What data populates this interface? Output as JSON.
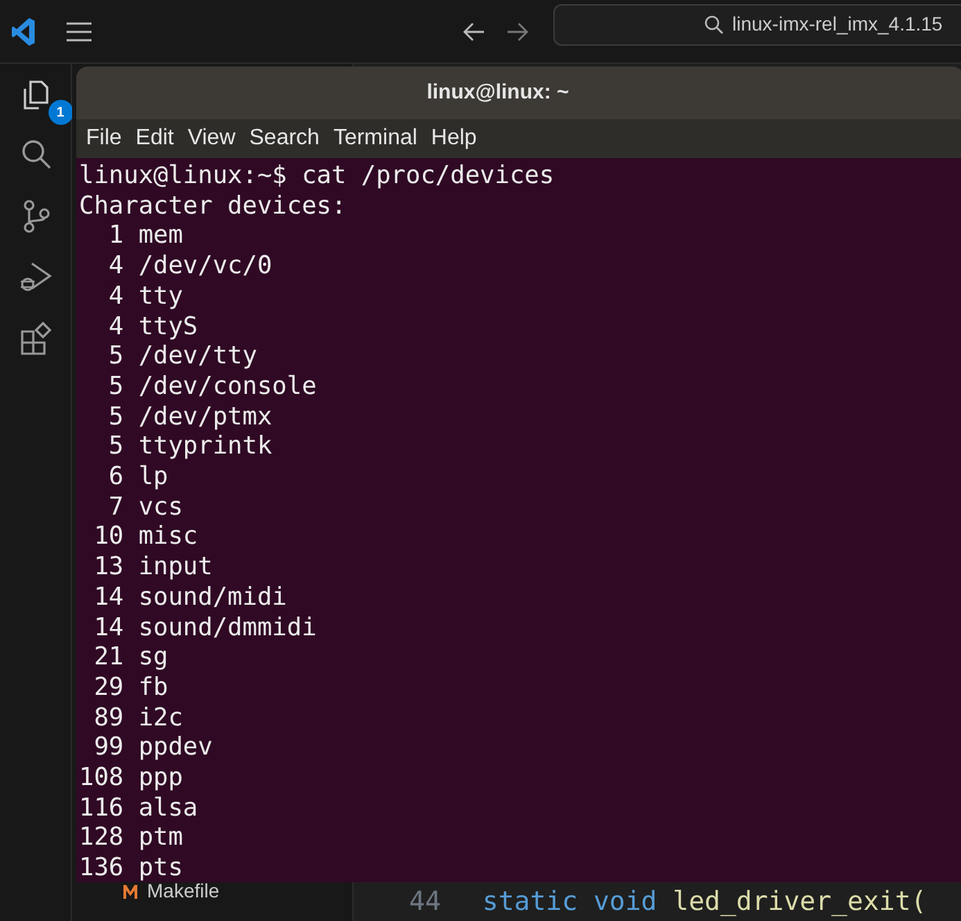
{
  "top_bar": {
    "search": {
      "value": "linux-imx-rel_imx_4.1.15"
    }
  },
  "activity_bar": {
    "items": [
      {
        "kind": "explorer",
        "badge": "1"
      },
      {
        "kind": "search"
      },
      {
        "kind": "source-control"
      },
      {
        "kind": "debug"
      },
      {
        "kind": "extensions"
      }
    ]
  },
  "explorer": {
    "file": "Makefile"
  },
  "editor": {
    "line_number": "44",
    "code": [
      {
        "text": "static void ",
        "kind": "keyword"
      },
      {
        "text": "led_driver_exit(",
        "kind": "function"
      }
    ]
  },
  "terminal": {
    "title": "linux@linux: ~",
    "menu": [
      "File",
      "Edit",
      "View",
      "Search",
      "Terminal",
      "Help"
    ],
    "lines": [
      "linux@linux:~$ cat /proc/devices",
      "Character devices:",
      "  1 mem",
      "  4 /dev/vc/0",
      "  4 tty",
      "  4 ttyS",
      "  5 /dev/tty",
      "  5 /dev/console",
      "  5 /dev/ptmx",
      "  5 ttyprintk",
      "  6 lp",
      "  7 vcs",
      " 10 misc",
      " 13 input",
      " 14 sound/midi",
      " 14 sound/dmmidi",
      " 21 sg",
      " 29 fb",
      " 89 i2c",
      " 99 ppdev",
      "108 ppp",
      "116 alsa",
      "128 ptm",
      "136 pts"
    ]
  }
}
